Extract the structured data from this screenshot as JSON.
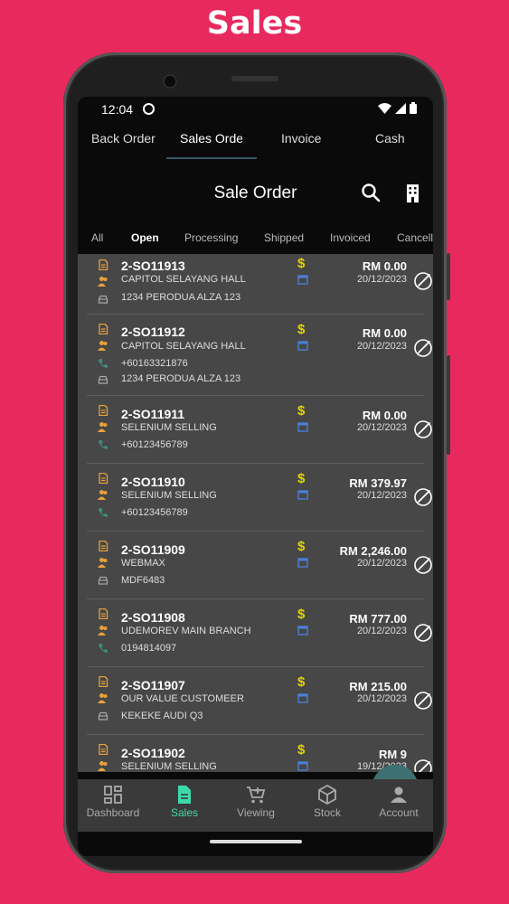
{
  "caption": "Sales",
  "status_bar": {
    "time": "12:04"
  },
  "top_tabs": [
    {
      "label": "Back Order"
    },
    {
      "label": "Sales Order",
      "active": true
    },
    {
      "label": "Invoice"
    },
    {
      "label": "Cash"
    }
  ],
  "toolbar": {
    "title": "Sale Order",
    "icons": [
      "search-icon",
      "building-icon"
    ]
  },
  "filter_tabs": [
    {
      "label": "All"
    },
    {
      "label": "Open",
      "active": true
    },
    {
      "label": "Processing"
    },
    {
      "label": "Shipped"
    },
    {
      "label": "Invoiced"
    },
    {
      "label": "Cancelle"
    }
  ],
  "orders": [
    {
      "order_no": "2-SO11913",
      "customer": "CAPITOL SELAYANG HALL",
      "phone": "",
      "vehicle": "1234 PERODUA ALZA 123",
      "amount": "RM 0.00",
      "date": "20/12/2023"
    },
    {
      "order_no": "2-SO11912",
      "customer": "CAPITOL SELAYANG HALL",
      "phone": "+60163321876",
      "vehicle": "1234 PERODUA ALZA 123",
      "amount": "RM 0.00",
      "date": "20/12/2023"
    },
    {
      "order_no": "2-SO11911",
      "customer": "SELENIUM SELLING",
      "phone": "+60123456789",
      "vehicle": "",
      "amount": "RM 0.00",
      "date": "20/12/2023"
    },
    {
      "order_no": "2-SO11910",
      "customer": "SELENIUM SELLING",
      "phone": "+60123456789",
      "vehicle": "",
      "amount": "RM 379.97",
      "date": "20/12/2023"
    },
    {
      "order_no": "2-SO11909",
      "customer": "WEBMAX",
      "phone": "",
      "vehicle": "MDF6483",
      "amount": "RM 2,246.00",
      "date": "20/12/2023"
    },
    {
      "order_no": "2-SO11908",
      "customer": "UDEMOREV MAIN BRANCH",
      "phone": "0194814097",
      "vehicle": "",
      "amount": "RM 777.00",
      "date": "20/12/2023"
    },
    {
      "order_no": "2-SO11907",
      "customer": "OUR VALUE CUSTOMEER",
      "phone": "",
      "vehicle": "KEKEKE AUDI  Q3",
      "amount": "RM 215.00",
      "date": "20/12/2023"
    },
    {
      "order_no": "2-SO11902",
      "customer": "SELENIUM SELLING",
      "phone": "",
      "vehicle": "",
      "amount": "RM 9",
      "date": "19/12/2023"
    }
  ],
  "fab": {
    "label": "+"
  },
  "bottom_nav": [
    {
      "label": "Dashboard",
      "icon": "dashboard-icon"
    },
    {
      "label": "Sales",
      "icon": "document-icon",
      "active": true
    },
    {
      "label": "Viewing",
      "icon": "cart-icon"
    },
    {
      "label": "Stock",
      "icon": "box-icon"
    },
    {
      "label": "Account",
      "icon": "person-icon"
    }
  ],
  "colors": {
    "background": "#E8295E",
    "accent": "#3ED9A9",
    "dollar": "#E6D300",
    "doc_icon": "#E8A23A",
    "calendar": "#4A7FD6",
    "fab": "#3D7070"
  }
}
